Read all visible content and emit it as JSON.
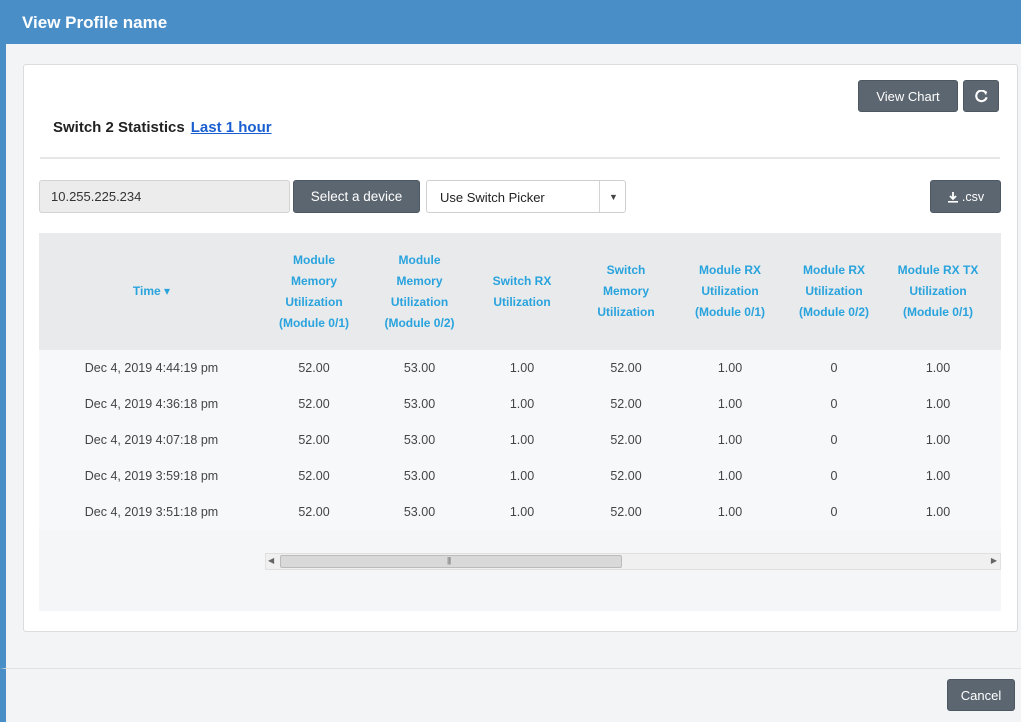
{
  "modal": {
    "title": "View Profile name"
  },
  "header": {
    "stats_title": "Switch 2 Statistics",
    "time_link": "Last 1 hour",
    "view_chart_label": "View Chart",
    "refresh_icon": "refresh-icon"
  },
  "controls": {
    "ip_value": "10.255.225.234",
    "select_device_label": "Select a device",
    "picker_value": "Use Switch Picker",
    "csv_label": ".csv",
    "csv_icon": "download-icon"
  },
  "table": {
    "headers": [
      "Time ▾",
      "Module Memory Utilization (Module 0/1)",
      "Module Memory Utilization (Module 0/2)",
      "Switch RX Utilization",
      "Switch Memory Utilization",
      "Module RX Utilization (Module 0/1)",
      "Module RX Utilization (Module 0/2)",
      "Module RX TX Utilization (Module 0/1)"
    ],
    "rows": [
      [
        "Dec 4, 2019 4:44:19 pm",
        "52.00",
        "53.00",
        "1.00",
        "52.00",
        "1.00",
        "0",
        "1.00"
      ],
      [
        "Dec 4, 2019 4:36:18 pm",
        "52.00",
        "53.00",
        "1.00",
        "52.00",
        "1.00",
        "0",
        "1.00"
      ],
      [
        "Dec 4, 2019 4:07:18 pm",
        "52.00",
        "53.00",
        "1.00",
        "52.00",
        "1.00",
        "0",
        "1.00"
      ],
      [
        "Dec 4, 2019 3:59:18 pm",
        "52.00",
        "53.00",
        "1.00",
        "52.00",
        "1.00",
        "0",
        "1.00"
      ],
      [
        "Dec 4, 2019 3:51:18 pm",
        "52.00",
        "53.00",
        "1.00",
        "52.00",
        "1.00",
        "0",
        "1.00"
      ]
    ]
  },
  "footer": {
    "cancel_label": "Cancel"
  },
  "colors": {
    "header_blue": "#4a8ec8",
    "link_blue": "#1a5fd1",
    "column_blue": "#29a3dd",
    "button_gray": "#5c6670"
  }
}
